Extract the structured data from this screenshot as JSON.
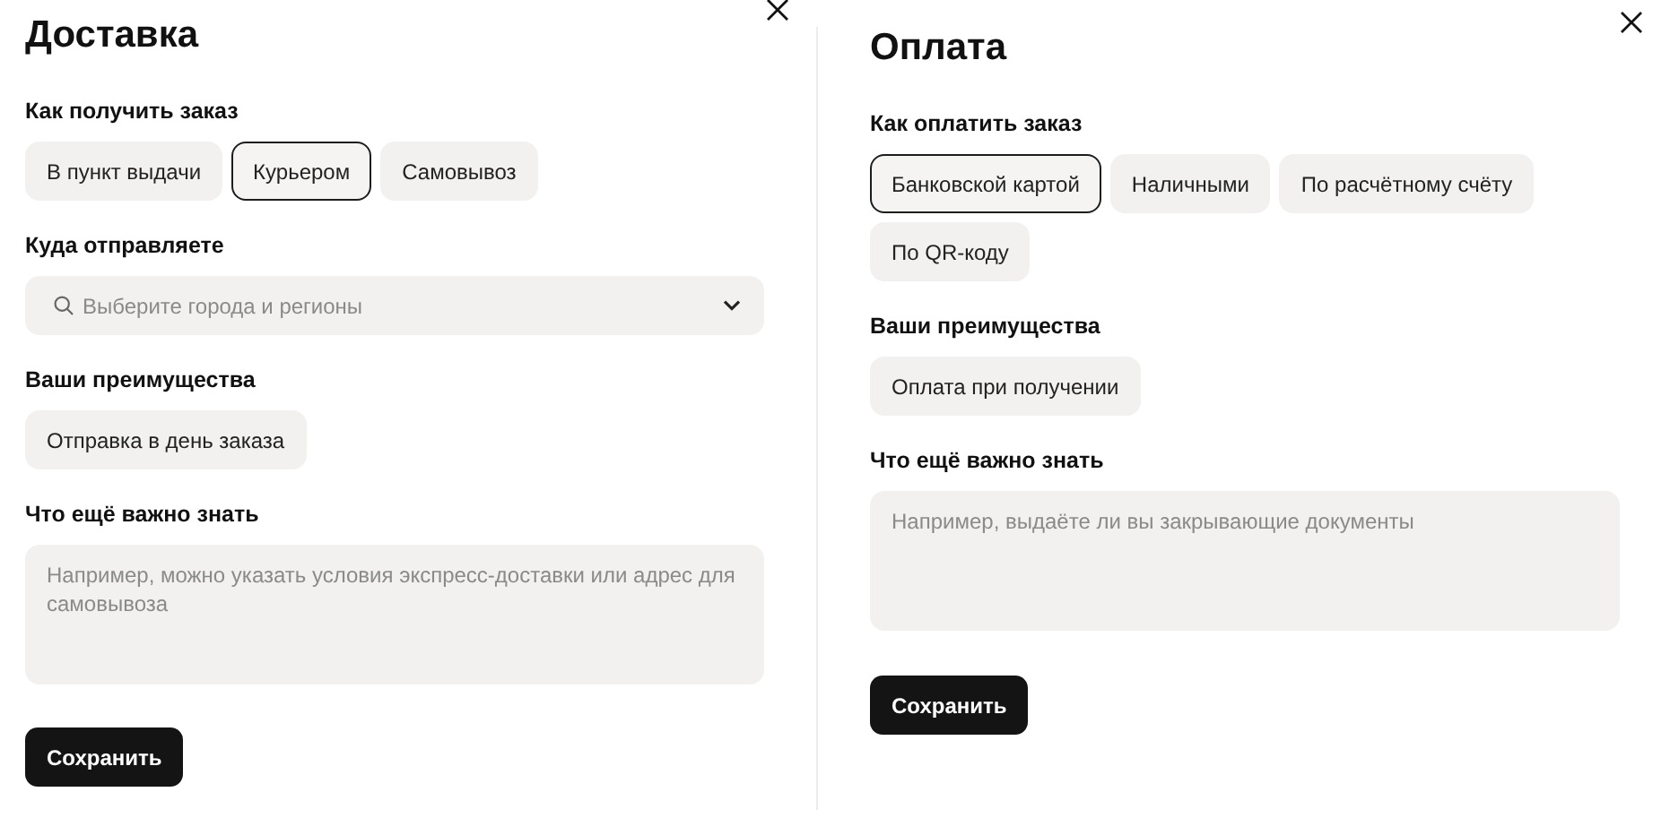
{
  "panels": [
    {
      "title": "Доставка",
      "sections": [
        {
          "kind": "chips",
          "label": "Как получить заказ",
          "options": [
            {
              "label": "В пункт выдачи",
              "selected": false
            },
            {
              "label": "Курьером",
              "selected": true
            },
            {
              "label": "Самовывоз",
              "selected": false
            }
          ]
        },
        {
          "kind": "select",
          "label": "Куда отправляете",
          "placeholder": "Выберите города и регионы"
        },
        {
          "kind": "chips",
          "label": "Ваши преимущества",
          "options": [
            {
              "label": "Отправка в день заказа",
              "selected": false
            }
          ]
        },
        {
          "kind": "textarea",
          "label": "Что ещё важно знать",
          "placeholder": "Например, можно указать условия экспресс-доставки или адрес для самовывоза"
        }
      ],
      "button": "Сохранить"
    },
    {
      "title": "Оплата",
      "sections": [
        {
          "kind": "chips",
          "label": "Как оплатить заказ",
          "options": [
            {
              "label": "Банковской картой",
              "selected": true
            },
            {
              "label": "Наличными",
              "selected": false
            },
            {
              "label": "По расчётному счёту",
              "selected": false
            },
            {
              "label": "По QR-коду",
              "selected": false
            }
          ]
        },
        {
          "kind": "chips",
          "label": "Ваши преимущества",
          "options": [
            {
              "label": "Оплата при получении",
              "selected": false
            }
          ]
        },
        {
          "kind": "textarea",
          "label": "Что ещё важно знать",
          "placeholder": "Например, выдаёте ли вы закрывающие документы"
        }
      ],
      "button": "Сохранить"
    }
  ]
}
